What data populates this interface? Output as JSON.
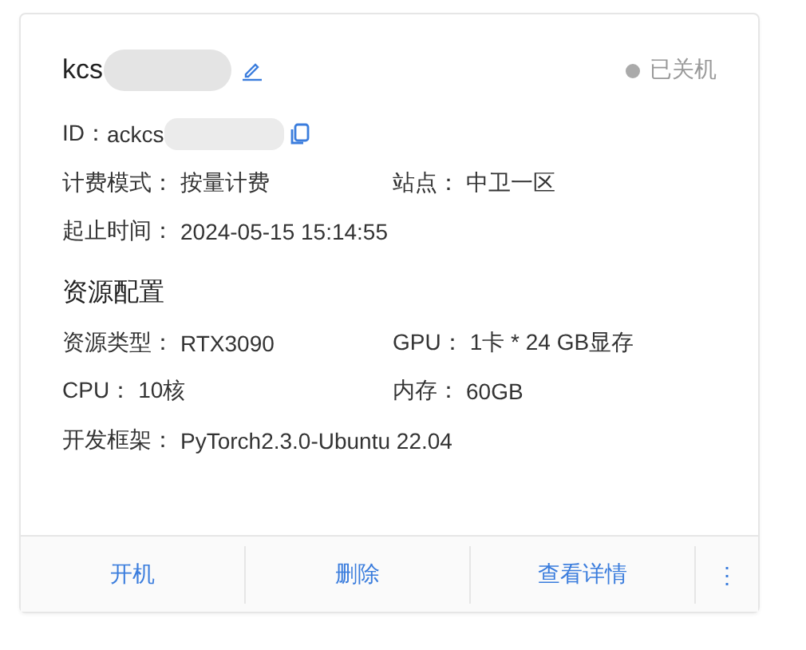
{
  "card": {
    "name": "kcs",
    "status": {
      "label": "已关机"
    },
    "id": {
      "label": "ID：",
      "value": "ackcs"
    },
    "info": [
      [
        {
          "label": "计费模式：",
          "value": "按量计费"
        },
        {
          "label": "站点：",
          "value": "中卫一区"
        }
      ],
      [
        {
          "label": "起止时间：",
          "value": "2024-05-15 15:14:55"
        }
      ]
    ],
    "section_title": "资源配置",
    "resources": [
      [
        {
          "label": "资源类型：",
          "value": "RTX3090"
        },
        {
          "label": "GPU：",
          "value": "1卡 * 24 GB显存"
        }
      ],
      [
        {
          "label": "CPU：",
          "value": "10核"
        },
        {
          "label": "内存：",
          "value": "60GB"
        }
      ],
      [
        {
          "label": "开发框架：",
          "value": "PyTorch2.3.0-Ubuntu 22.04"
        }
      ]
    ],
    "actions": [
      "开机",
      "删除",
      "查看详情"
    ],
    "more": "⋮"
  }
}
